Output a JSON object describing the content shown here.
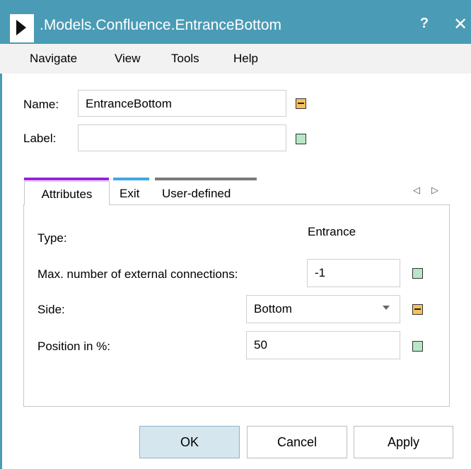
{
  "window": {
    "title": ".Models.Confluence.EntranceBottom",
    "help_label": "?",
    "close_label": "✕"
  },
  "menu": {
    "items": [
      {
        "label": "Navigate"
      },
      {
        "label": "View"
      },
      {
        "label": "Tools"
      },
      {
        "label": "Help"
      }
    ]
  },
  "header_fields": {
    "name": {
      "label": "Name:",
      "value": "EntranceBottom",
      "indicator": "orange"
    },
    "label": {
      "label": "Label:",
      "value": "",
      "indicator": "green"
    }
  },
  "tabs": [
    {
      "label": "Attributes",
      "accent": "#9b20e0",
      "active": true
    },
    {
      "label": "Exit",
      "accent": "#3fa7e8",
      "active": false
    },
    {
      "label": "User-defined",
      "accent": "#7a7a7a",
      "active": false
    }
  ],
  "tab_nav": {
    "prev": "◁",
    "next": "▷"
  },
  "attributes": {
    "type": {
      "label": "Type:",
      "value": "Entrance"
    },
    "max_connections": {
      "label": "Max. number of external connections:",
      "value": "-1",
      "indicator": "green"
    },
    "side": {
      "label": "Side:",
      "value": "Bottom",
      "indicator": "orange"
    },
    "position": {
      "label": "Position in %:",
      "value": "50",
      "indicator": "green"
    }
  },
  "buttons": {
    "ok": "OK",
    "cancel": "Cancel",
    "apply": "Apply"
  },
  "colors": {
    "titlebar": "#4a9bb5",
    "indicator_green": "#b6e8c6",
    "indicator_orange": "#f6c15b"
  }
}
